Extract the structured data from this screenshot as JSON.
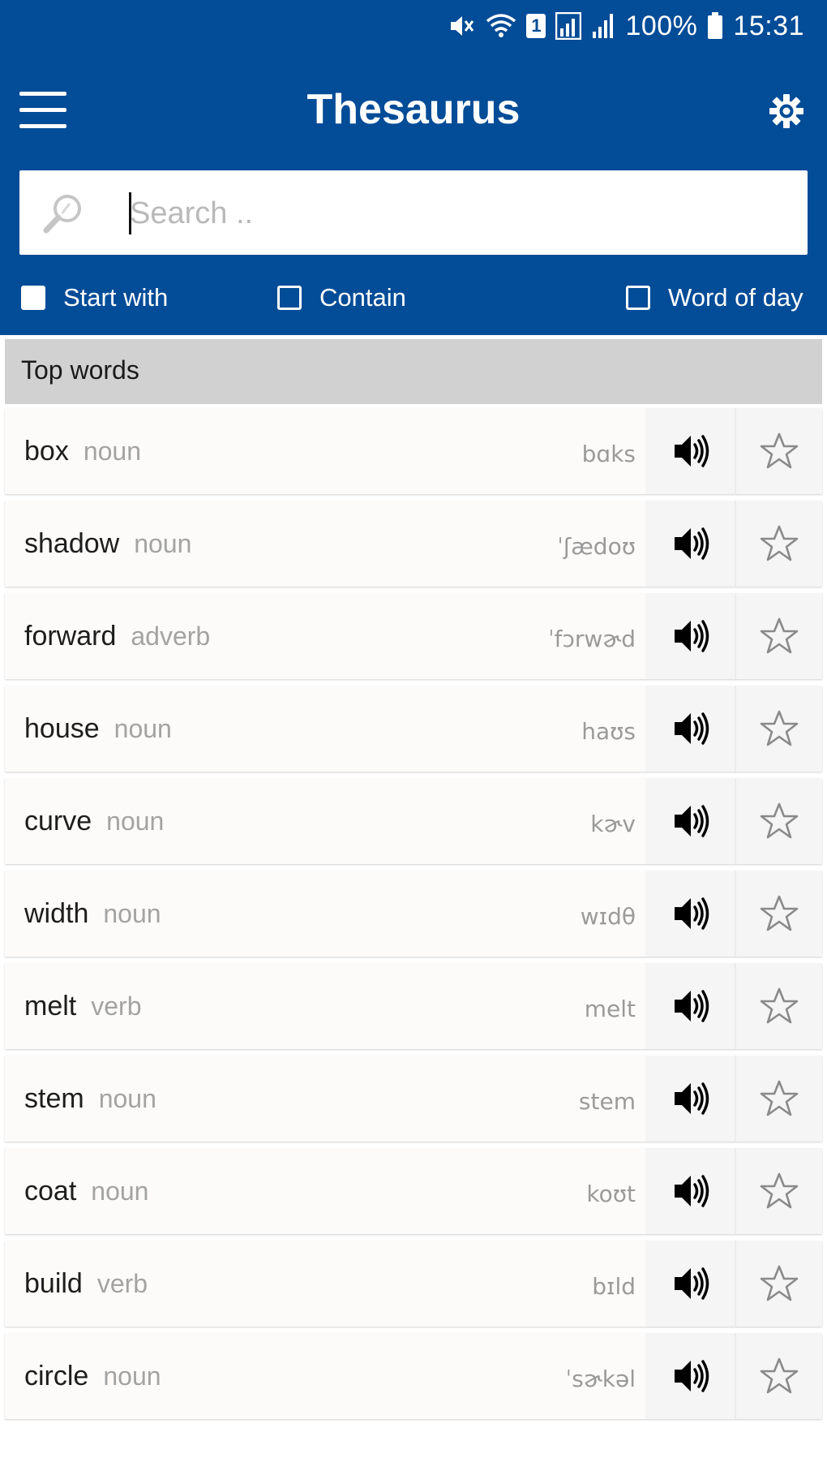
{
  "status_bar": {
    "icons": [
      "mute-icon",
      "wifi-icon",
      "sim-badge-icon",
      "signal-icon",
      "signal-bars-icon",
      "battery-icon"
    ],
    "sim_label": "1",
    "battery": "100%",
    "time": "15:31"
  },
  "appbar": {
    "title": "Thesaurus",
    "menu_icon": "hamburger-menu-icon",
    "settings_icon": "gear-icon"
  },
  "search": {
    "placeholder": "Search ..",
    "value": ""
  },
  "filters": [
    {
      "label": "Start with",
      "checked": true
    },
    {
      "label": "Contain",
      "checked": false
    },
    {
      "label": "Word of day",
      "checked": false
    }
  ],
  "section": {
    "title": "Top words"
  },
  "words": [
    {
      "word": "box",
      "pos": "noun",
      "ipa": "bɑks"
    },
    {
      "word": "shadow",
      "pos": "noun",
      "ipa": "ˈʃædoʊ"
    },
    {
      "word": "forward",
      "pos": "adverb",
      "ipa": "ˈfɔrwɚd"
    },
    {
      "word": "house",
      "pos": "noun",
      "ipa": "haʊs"
    },
    {
      "word": "curve",
      "pos": "noun",
      "ipa": "kɚv"
    },
    {
      "word": "width",
      "pos": "noun",
      "ipa": "wɪdθ"
    },
    {
      "word": "melt",
      "pos": "verb",
      "ipa": "melt"
    },
    {
      "word": "stem",
      "pos": "noun",
      "ipa": "stem"
    },
    {
      "word": "coat",
      "pos": "noun",
      "ipa": "koʊt"
    },
    {
      "word": "build",
      "pos": "verb",
      "ipa": "bɪld"
    },
    {
      "word": "circle",
      "pos": "noun",
      "ipa": "ˈsɚkəl"
    }
  ],
  "colors": {
    "primary": "#034c97",
    "section_bg": "#d1d1d1"
  }
}
